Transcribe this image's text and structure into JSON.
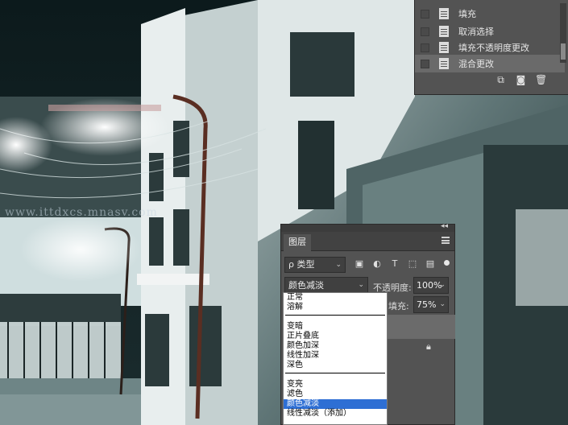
{
  "watermark": "www.ittdxcs.mnasv.com",
  "history": {
    "items": [
      {
        "label": "填充",
        "selected": false
      },
      {
        "label": "取消选择",
        "selected": false
      },
      {
        "label": "填充不透明度更改",
        "selected": false
      },
      {
        "label": "混合更改",
        "selected": true
      }
    ],
    "buttons": [
      "new-snapshot-icon",
      "camera-icon",
      "trash-icon"
    ]
  },
  "layers": {
    "tab_label": "图层",
    "filter": {
      "label": "ρ 类型"
    },
    "filter_icons": [
      "image-filter-icon",
      "adjustment-filter-icon",
      "type-filter-icon",
      "shape-filter-icon",
      "smart-object-filter-icon"
    ],
    "blend_mode": "颜色减淡",
    "opacity_label": "不透明度:",
    "opacity_value": "100%",
    "fill_label": "填充:",
    "fill_value": "75%"
  },
  "blend_menu": {
    "groups": [
      [
        "正常",
        "溶解"
      ],
      [
        "变暗",
        "正片叠底",
        "颜色加深",
        "线性加深",
        "深色"
      ],
      [
        "变亮",
        "滤色",
        "颜色减淡",
        "线性减淡（添加）"
      ]
    ],
    "selected": "颜色减淡"
  },
  "colors": {
    "panel_bg": "#535353",
    "selection_blue": "#2e6fd4"
  }
}
